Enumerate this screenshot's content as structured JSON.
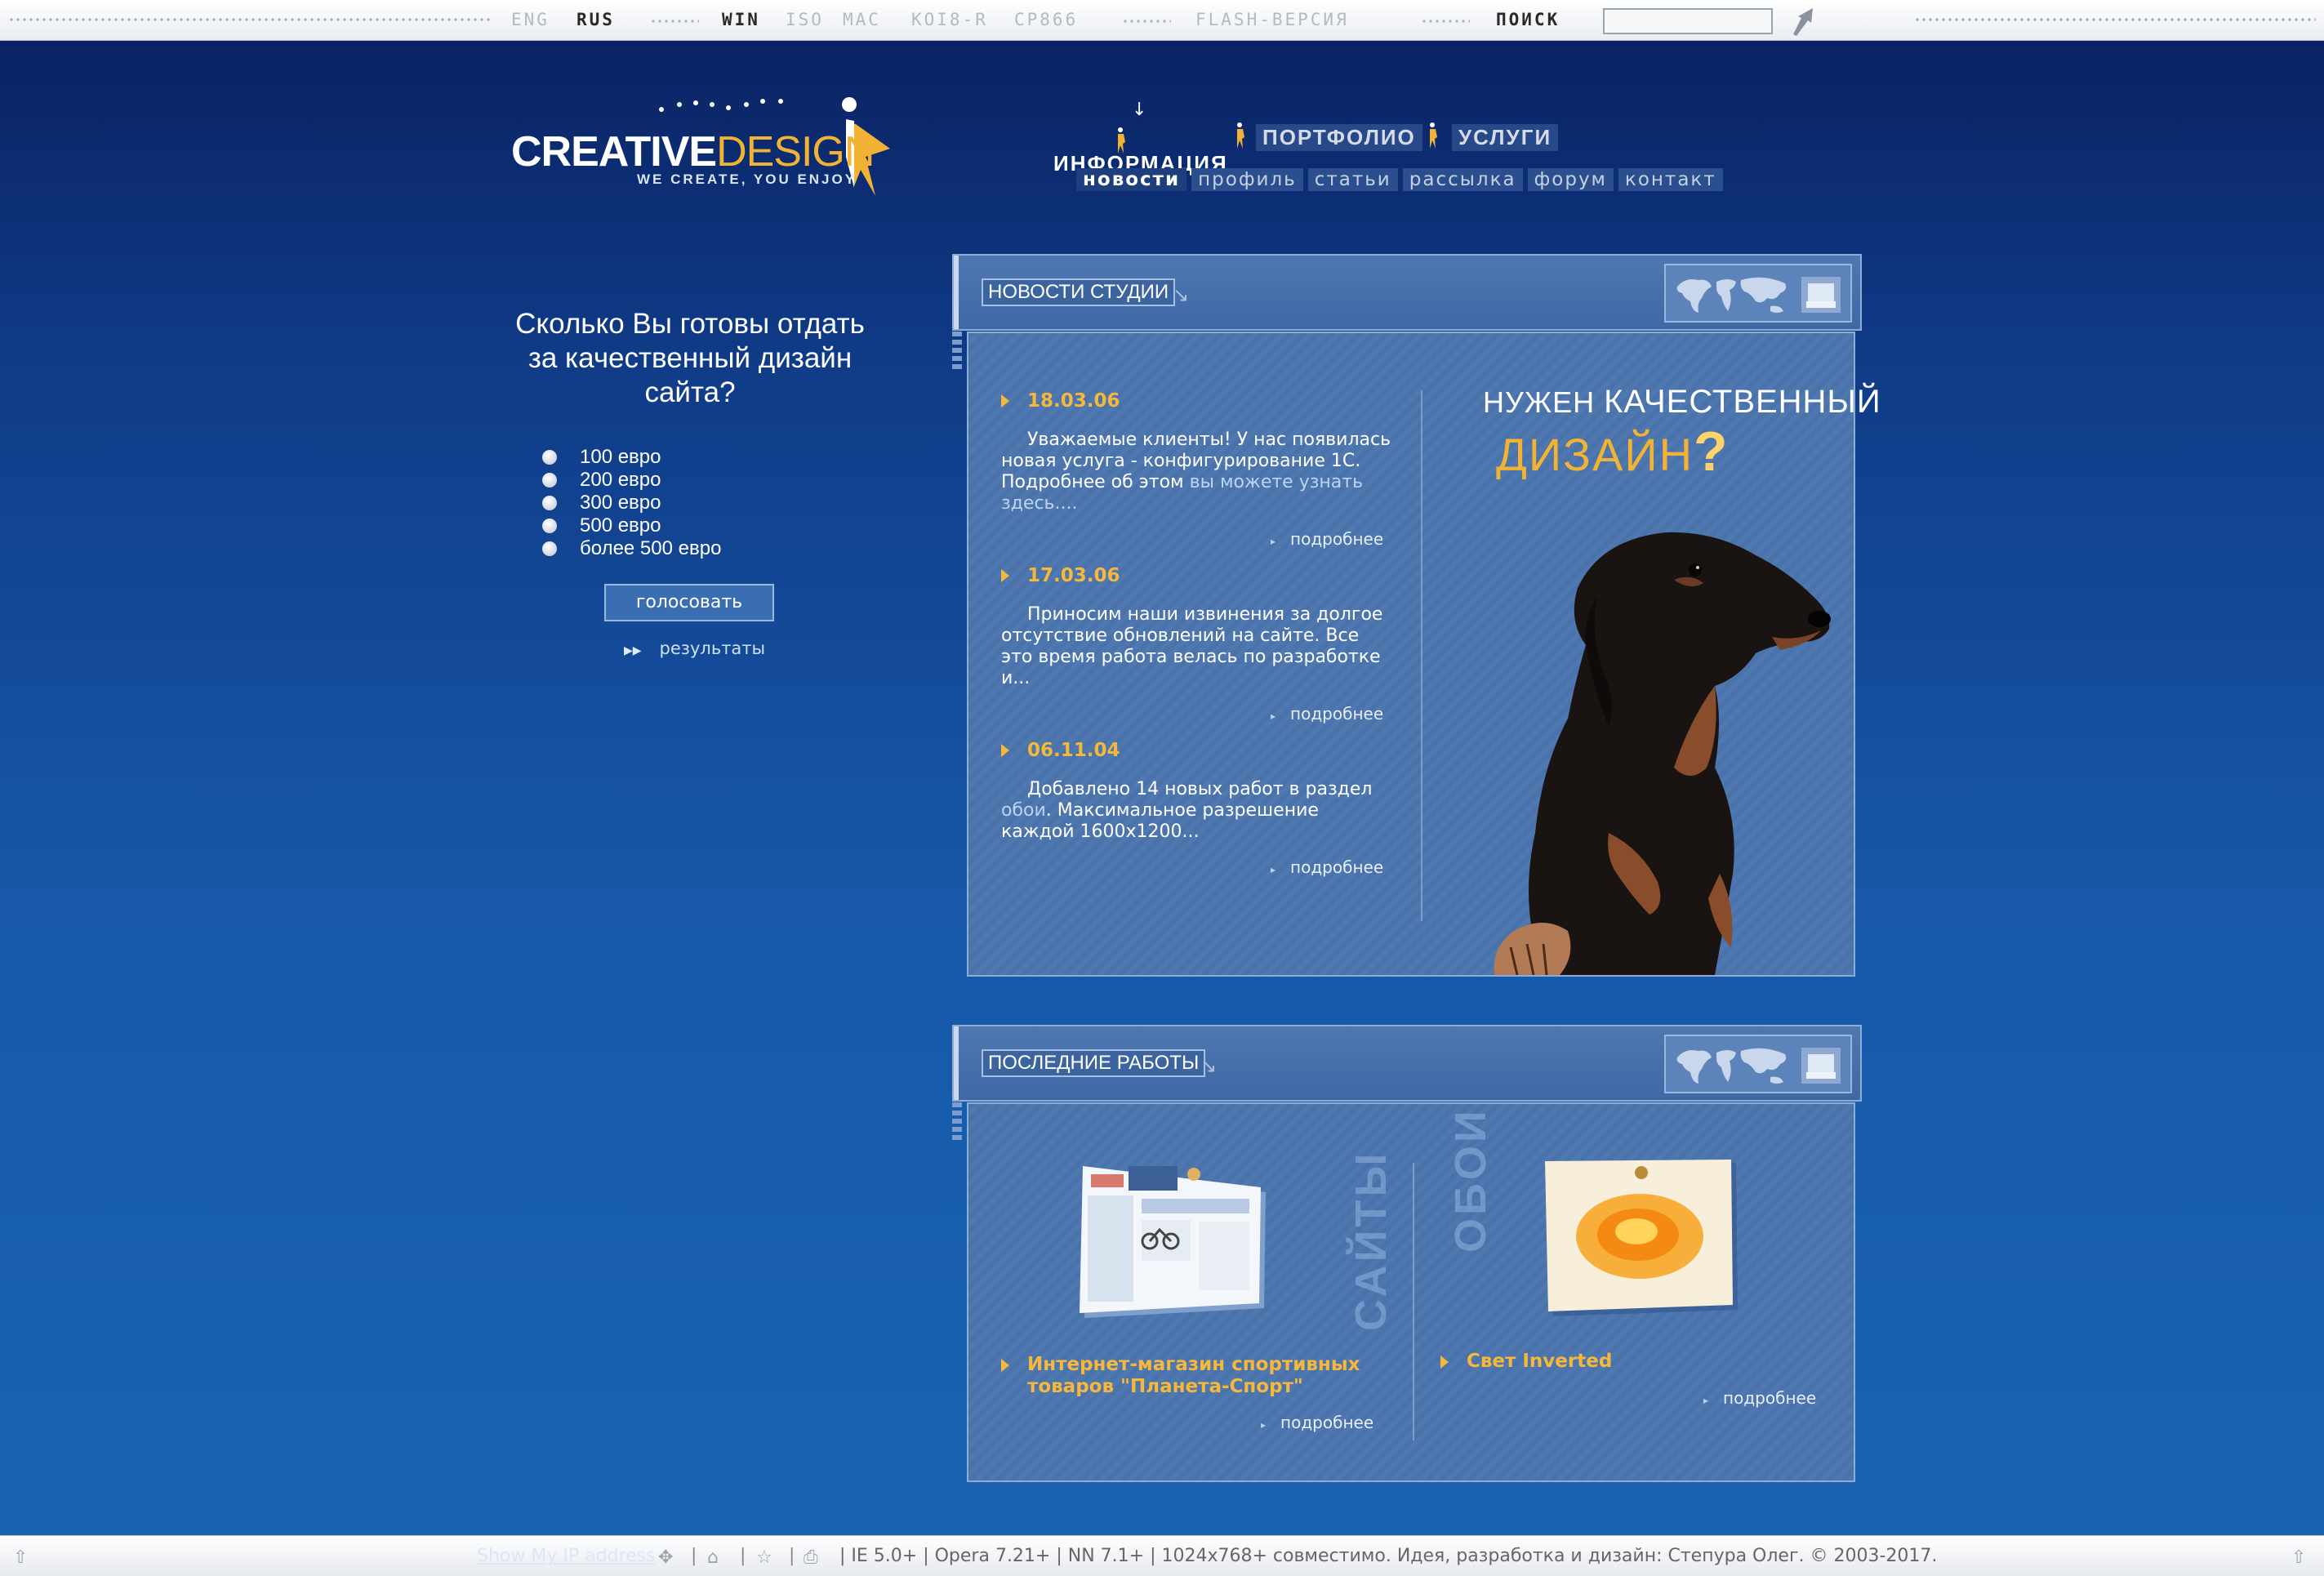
{
  "topbar": {
    "lang_eng": "ENG",
    "lang_rus": "RUS",
    "enc_win": "WIN",
    "enc_iso": "ISO",
    "enc_mac": "MAC",
    "enc_koi": "KOI8-R",
    "enc_cp": "CP866",
    "flash": "FLASH-ВЕРСИЯ",
    "search_label": "ПОИСК",
    "search_value": ""
  },
  "logo": {
    "word1": "CREATIVE",
    "word2": "DESIGN",
    "tagline": "WE CREATE, YOU ENJOY"
  },
  "nav": {
    "info": "ИНФОРМАЦИЯ",
    "portfolio": "ПОРТФОЛИО",
    "services": "УСЛУГИ",
    "sub": {
      "news": "новости",
      "profile": "профиль",
      "articles": "статьи",
      "mailing": "рассылка",
      "forum": "форум",
      "contact": "контакт"
    }
  },
  "poll": {
    "question": "Сколько Вы готовы отдать за качественный дизайн сайта?",
    "options": [
      "100 евро",
      "200 евро",
      "300 евро",
      "500 евро",
      "более 500 евро"
    ],
    "vote_label": "голосовать",
    "results_label": "результаты"
  },
  "news": {
    "title": "НОВОСТИ СТУДИИ",
    "items": [
      {
        "date": "18.03.06",
        "text": "Уважаемые клиенты! У нас появилась новая услуга - конфигурирование 1С. Подробнее об этом ",
        "link": "вы можете узнать здесь....",
        "more": "подробнее"
      },
      {
        "date": "17.03.06",
        "text": "Приносим наши извинения за долгое отсутствие обновлений на сайте. Все это время работа велась по разработке и...",
        "link": "",
        "more": "подробнее"
      },
      {
        "date": "06.11.04",
        "text": "Добавлено 14 новых работ в раздел ",
        "link": "обои",
        "text2": ". Максимальное разрешение каждой 1600x1200...",
        "more": "подробнее"
      }
    ],
    "promo_line1_small": "НУЖЕН ",
    "promo_line1_big": "КАЧЕСТВЕННЫЙ",
    "promo_line2": "ДИЗАЙН",
    "promo_q": "?"
  },
  "works": {
    "title": "ПОСЛЕДНИЕ РАБОТЫ",
    "col1_vertical": "САЙТЫ",
    "col2_vertical": "ОБОИ",
    "item1_title": "Интернет-магазин спортивных товаров \"Планета-Спорт\"",
    "item2_title": "Свет Inverted",
    "more": "подробнее"
  },
  "footer": {
    "ip_link": "Show My IP address",
    "text": "| IE 5.0+ | Opera 7.21+ | NN 7.1+ | 1024x768+ совместимо. Идея, разработка и дизайн: Степура Олег. © 2003-2017."
  },
  "colors": {
    "accent": "#f5b83a",
    "background_top": "#0a1f5e",
    "background_bottom": "#1a63b3",
    "panel": "#4a73ac"
  }
}
